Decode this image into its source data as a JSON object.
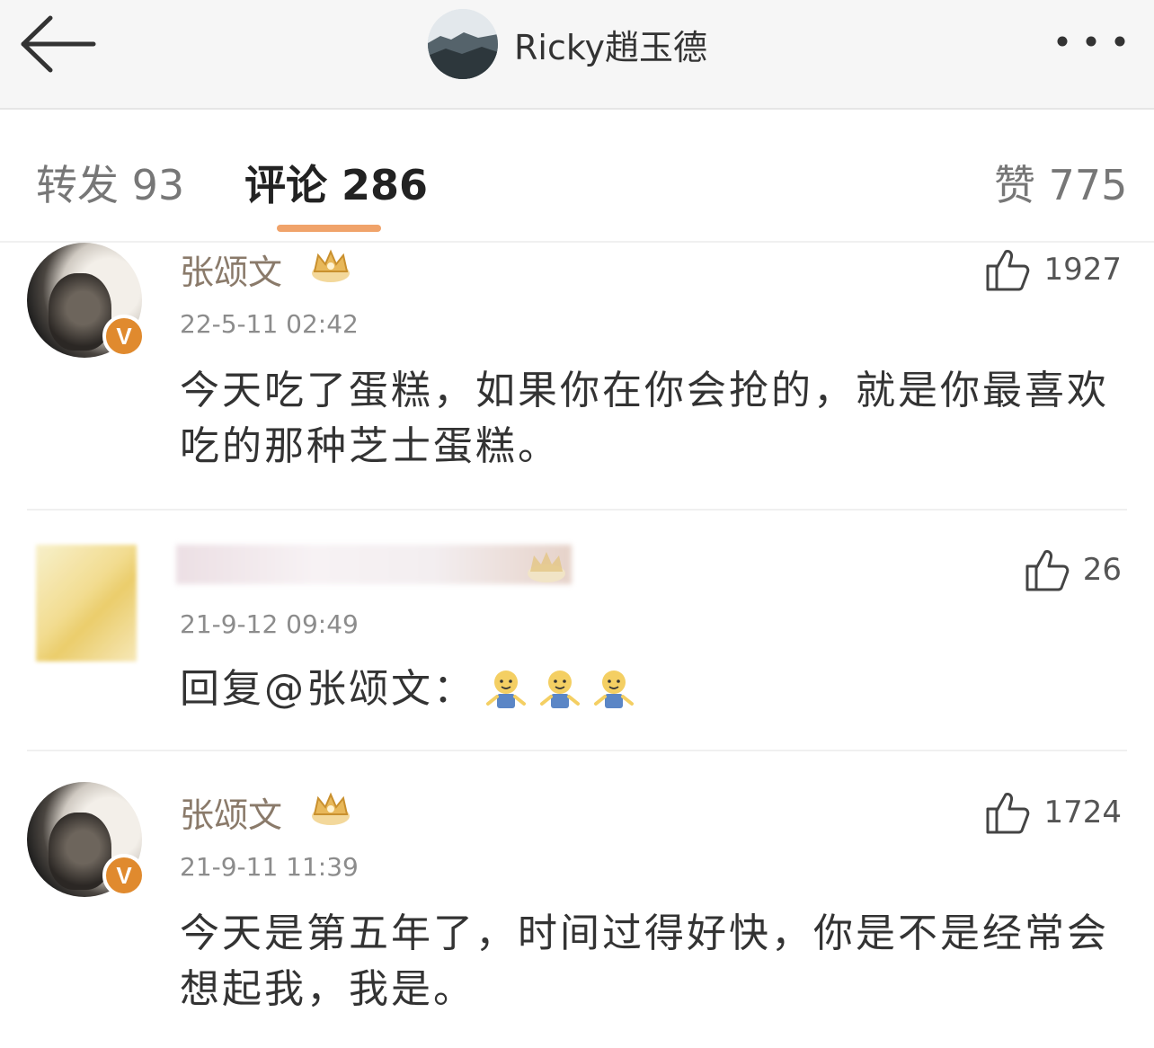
{
  "header": {
    "title": "Ricky趙玉德",
    "back_icon": "arrow-left-icon",
    "more_icon": "more-dots-icon"
  },
  "tabs": {
    "repost": "转发 93",
    "comments": "评论 286",
    "likes": "赞 775"
  },
  "comments": [
    {
      "user": "张颂文",
      "verified": true,
      "time": "22-5-11 02:42",
      "text": "今天吃了蛋糕，如果你在你会抢的，就是你最喜欢吃的那种芝士蛋糕。",
      "likes": "1927"
    },
    {
      "user": "",
      "verified": false,
      "time": "21-9-12 09:49",
      "text": "回复@张颂文：",
      "emoji": [
        "person-emoji",
        "person-emoji",
        "person-emoji"
      ],
      "likes": "26"
    },
    {
      "user": "张颂文",
      "verified": true,
      "time": "21-9-11 11:39",
      "text": "今天是第五年了，时间过得好快，你是不是经常会想起我，我是。",
      "likes": "1724"
    }
  ],
  "colors": {
    "accent_underline": "#f0a36a",
    "verified_badge": "#e08a2e",
    "name_color": "#8a7a6a"
  }
}
